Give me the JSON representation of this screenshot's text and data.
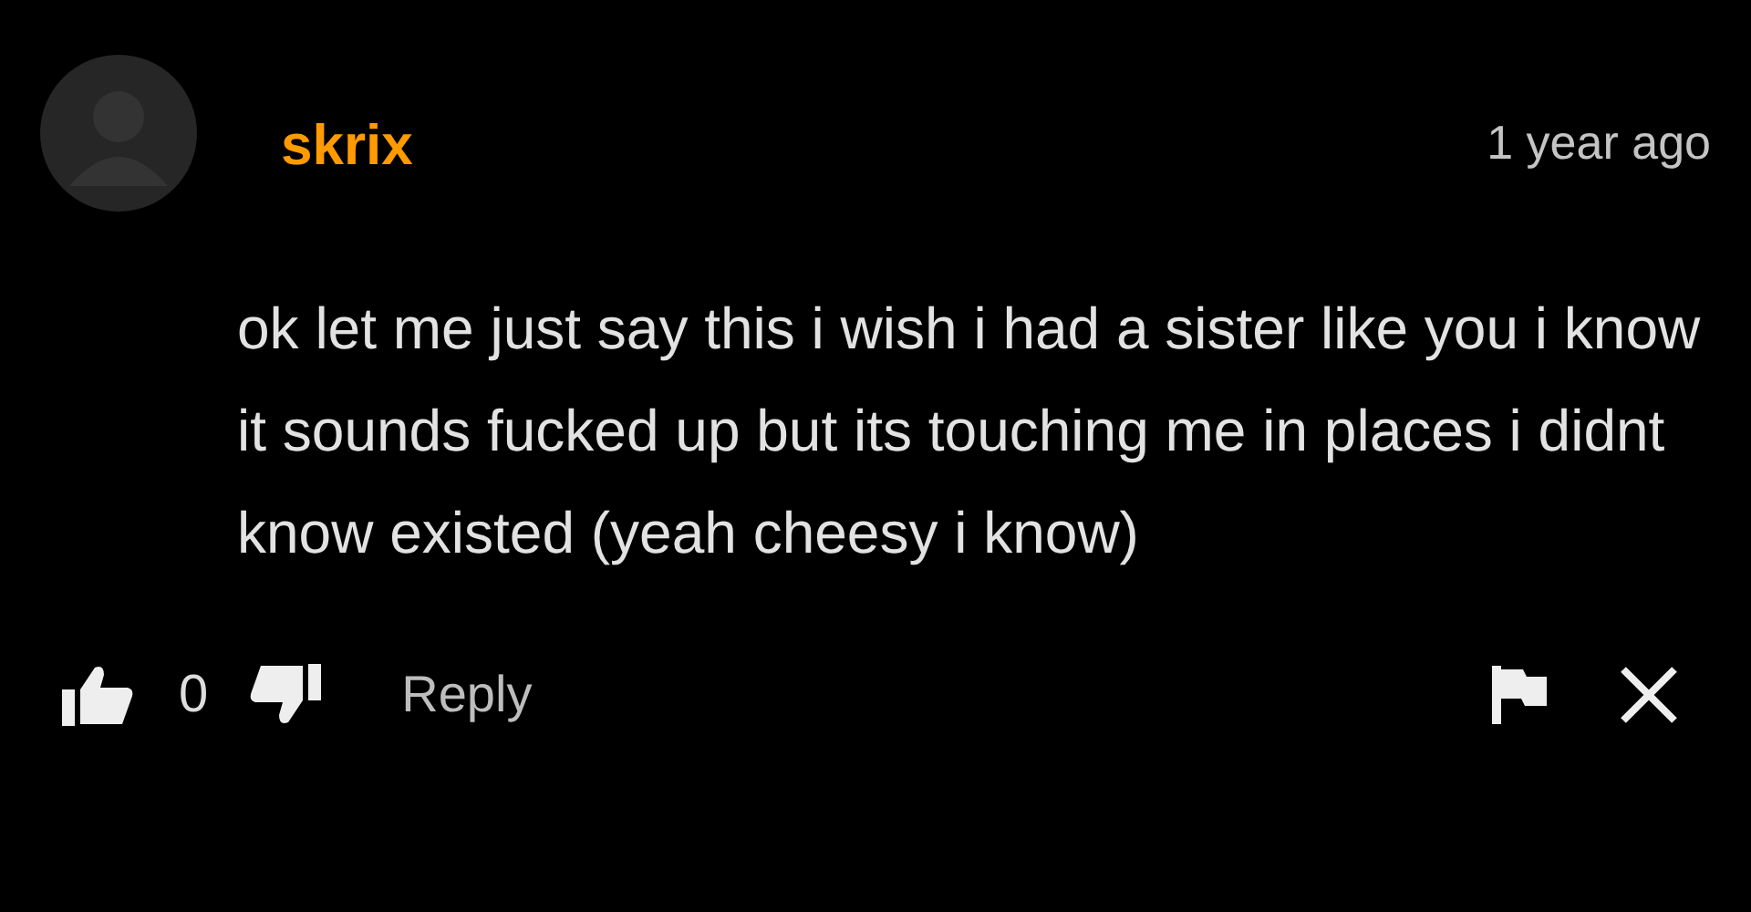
{
  "comment": {
    "author": "skrix",
    "time": "1 year ago",
    "body": "ok let me just say this i wish i had a sister like you i know it sounds fucked up but its touching me in places i didnt know existed (yeah cheesy i know)",
    "likes": "0",
    "reply": "Reply"
  }
}
